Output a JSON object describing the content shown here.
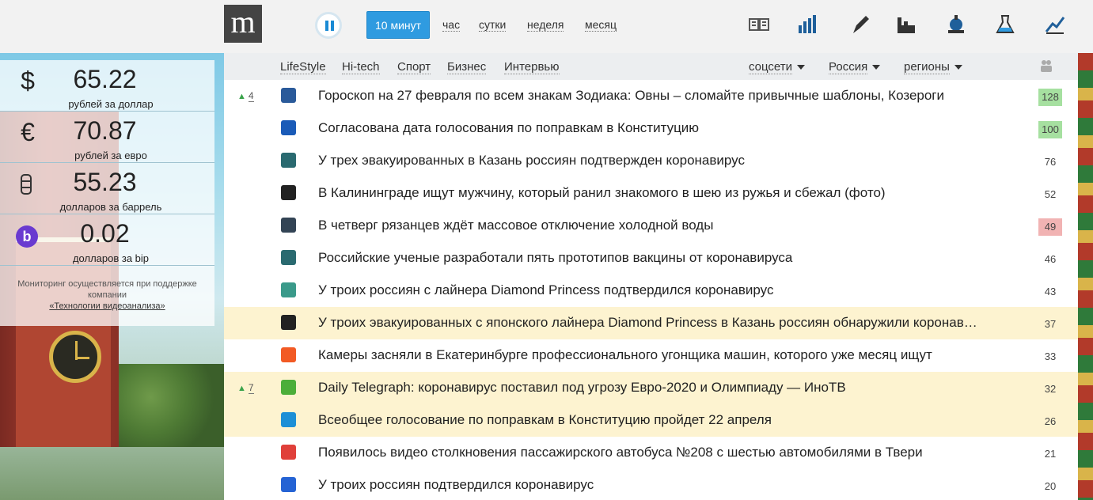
{
  "header": {
    "logo": "m",
    "time_filters": [
      "10 минут",
      "час",
      "сутки",
      "неделя",
      "месяц"
    ],
    "active_filter": "10 минут",
    "categories": [
      "books-icon",
      "bar-chart-icon",
      "pen-icon",
      "factory-icon",
      "chess-icon",
      "flask-icon",
      "trend-chart-icon"
    ]
  },
  "widget": {
    "rates": [
      {
        "symbol": "$",
        "value": "65.22",
        "label": "рублей за доллар"
      },
      {
        "symbol": "€",
        "value": "70.87",
        "label": "рублей за евро"
      },
      {
        "symbol": "",
        "value": "55.23",
        "label": "долларов за баррель"
      },
      {
        "symbol": "b",
        "value": "0.02",
        "label": "долларов за bip"
      }
    ],
    "support_text": "Мониторинг осуществляется при поддержке компании",
    "support_link": "«Технологии видеоанализа»"
  },
  "subnav": {
    "topics": [
      "LifeStyle",
      "Hi-tech",
      "Спорт",
      "Бизнес",
      "Интервью"
    ],
    "dropdowns": [
      "соцсети",
      "Россия",
      "регионы"
    ]
  },
  "news": [
    {
      "rank": "4",
      "title": "Гороскоп на 27 февраля по всем знакам Зодиака: Овны – сломайте привычные шаблоны, Козероги",
      "count": "128",
      "badge": "green",
      "highlight": false,
      "src_color": "#2a5a9a"
    },
    {
      "rank": "",
      "title": "Согласована дата голосования по поправкам в Конституцию",
      "count": "100",
      "badge": "green",
      "highlight": false,
      "src_color": "#1a5bb8"
    },
    {
      "rank": "",
      "title": "У трех эвакуированных в Казань россиян подтвержден коронавирус",
      "count": "76",
      "badge": "",
      "highlight": false,
      "src_color": "#2a6a70"
    },
    {
      "rank": "",
      "title": "В Калининграде ищут мужчину, который ранил знакомого в шею из ружья и сбежал (фото)",
      "count": "52",
      "badge": "",
      "highlight": false,
      "src_color": "#222222"
    },
    {
      "rank": "",
      "title": "В четверг рязанцев ждёт массовое отключение холодной воды",
      "count": "49",
      "badge": "red",
      "highlight": false,
      "src_color": "#334455"
    },
    {
      "rank": "",
      "title": "Российские ученые разработали пять прототипов вакцины от коронавируса",
      "count": "46",
      "badge": "",
      "highlight": false,
      "src_color": "#2a6a70"
    },
    {
      "rank": "",
      "title": "У троих россиян с лайнера Diamond Princess подтвердился коронавирус",
      "count": "43",
      "badge": "",
      "highlight": false,
      "src_color": "#3a9a8a"
    },
    {
      "rank": "",
      "title": "У троих эвакуированных с японского лайнера Diamond Princess в Казань россиян обнаружили коронавирус",
      "count": "37",
      "badge": "",
      "highlight": true,
      "src_color": "#222222"
    },
    {
      "rank": "",
      "title": "Камеры засняли в Екатеринбурге профессионального угонщика машин, которого уже месяц ищут",
      "count": "33",
      "badge": "",
      "highlight": false,
      "src_color": "#f25a24"
    },
    {
      "rank": "7",
      "title": "Daily Telegraph: коронавирус поставил под угрозу Евро-2020 и Олимпиаду — ИноТВ",
      "count": "32",
      "badge": "",
      "highlight": true,
      "src_color": "#4cae3a"
    },
    {
      "rank": "",
      "title": "Всеобщее голосование по поправкам в Конституцию пройдет 22 апреля",
      "count": "26",
      "badge": "",
      "highlight": true,
      "src_color": "#1c8fd6"
    },
    {
      "rank": "",
      "title": "Появилось видео столкновения пассажирского автобуса №208 с шестью автомобилями в Твери",
      "count": "21",
      "badge": "",
      "highlight": false,
      "src_color": "#e0403a"
    },
    {
      "rank": "",
      "title": "У троих россиян подтвердился коронавирус",
      "count": "20",
      "badge": "",
      "highlight": false,
      "src_color": "#2563d4"
    }
  ]
}
